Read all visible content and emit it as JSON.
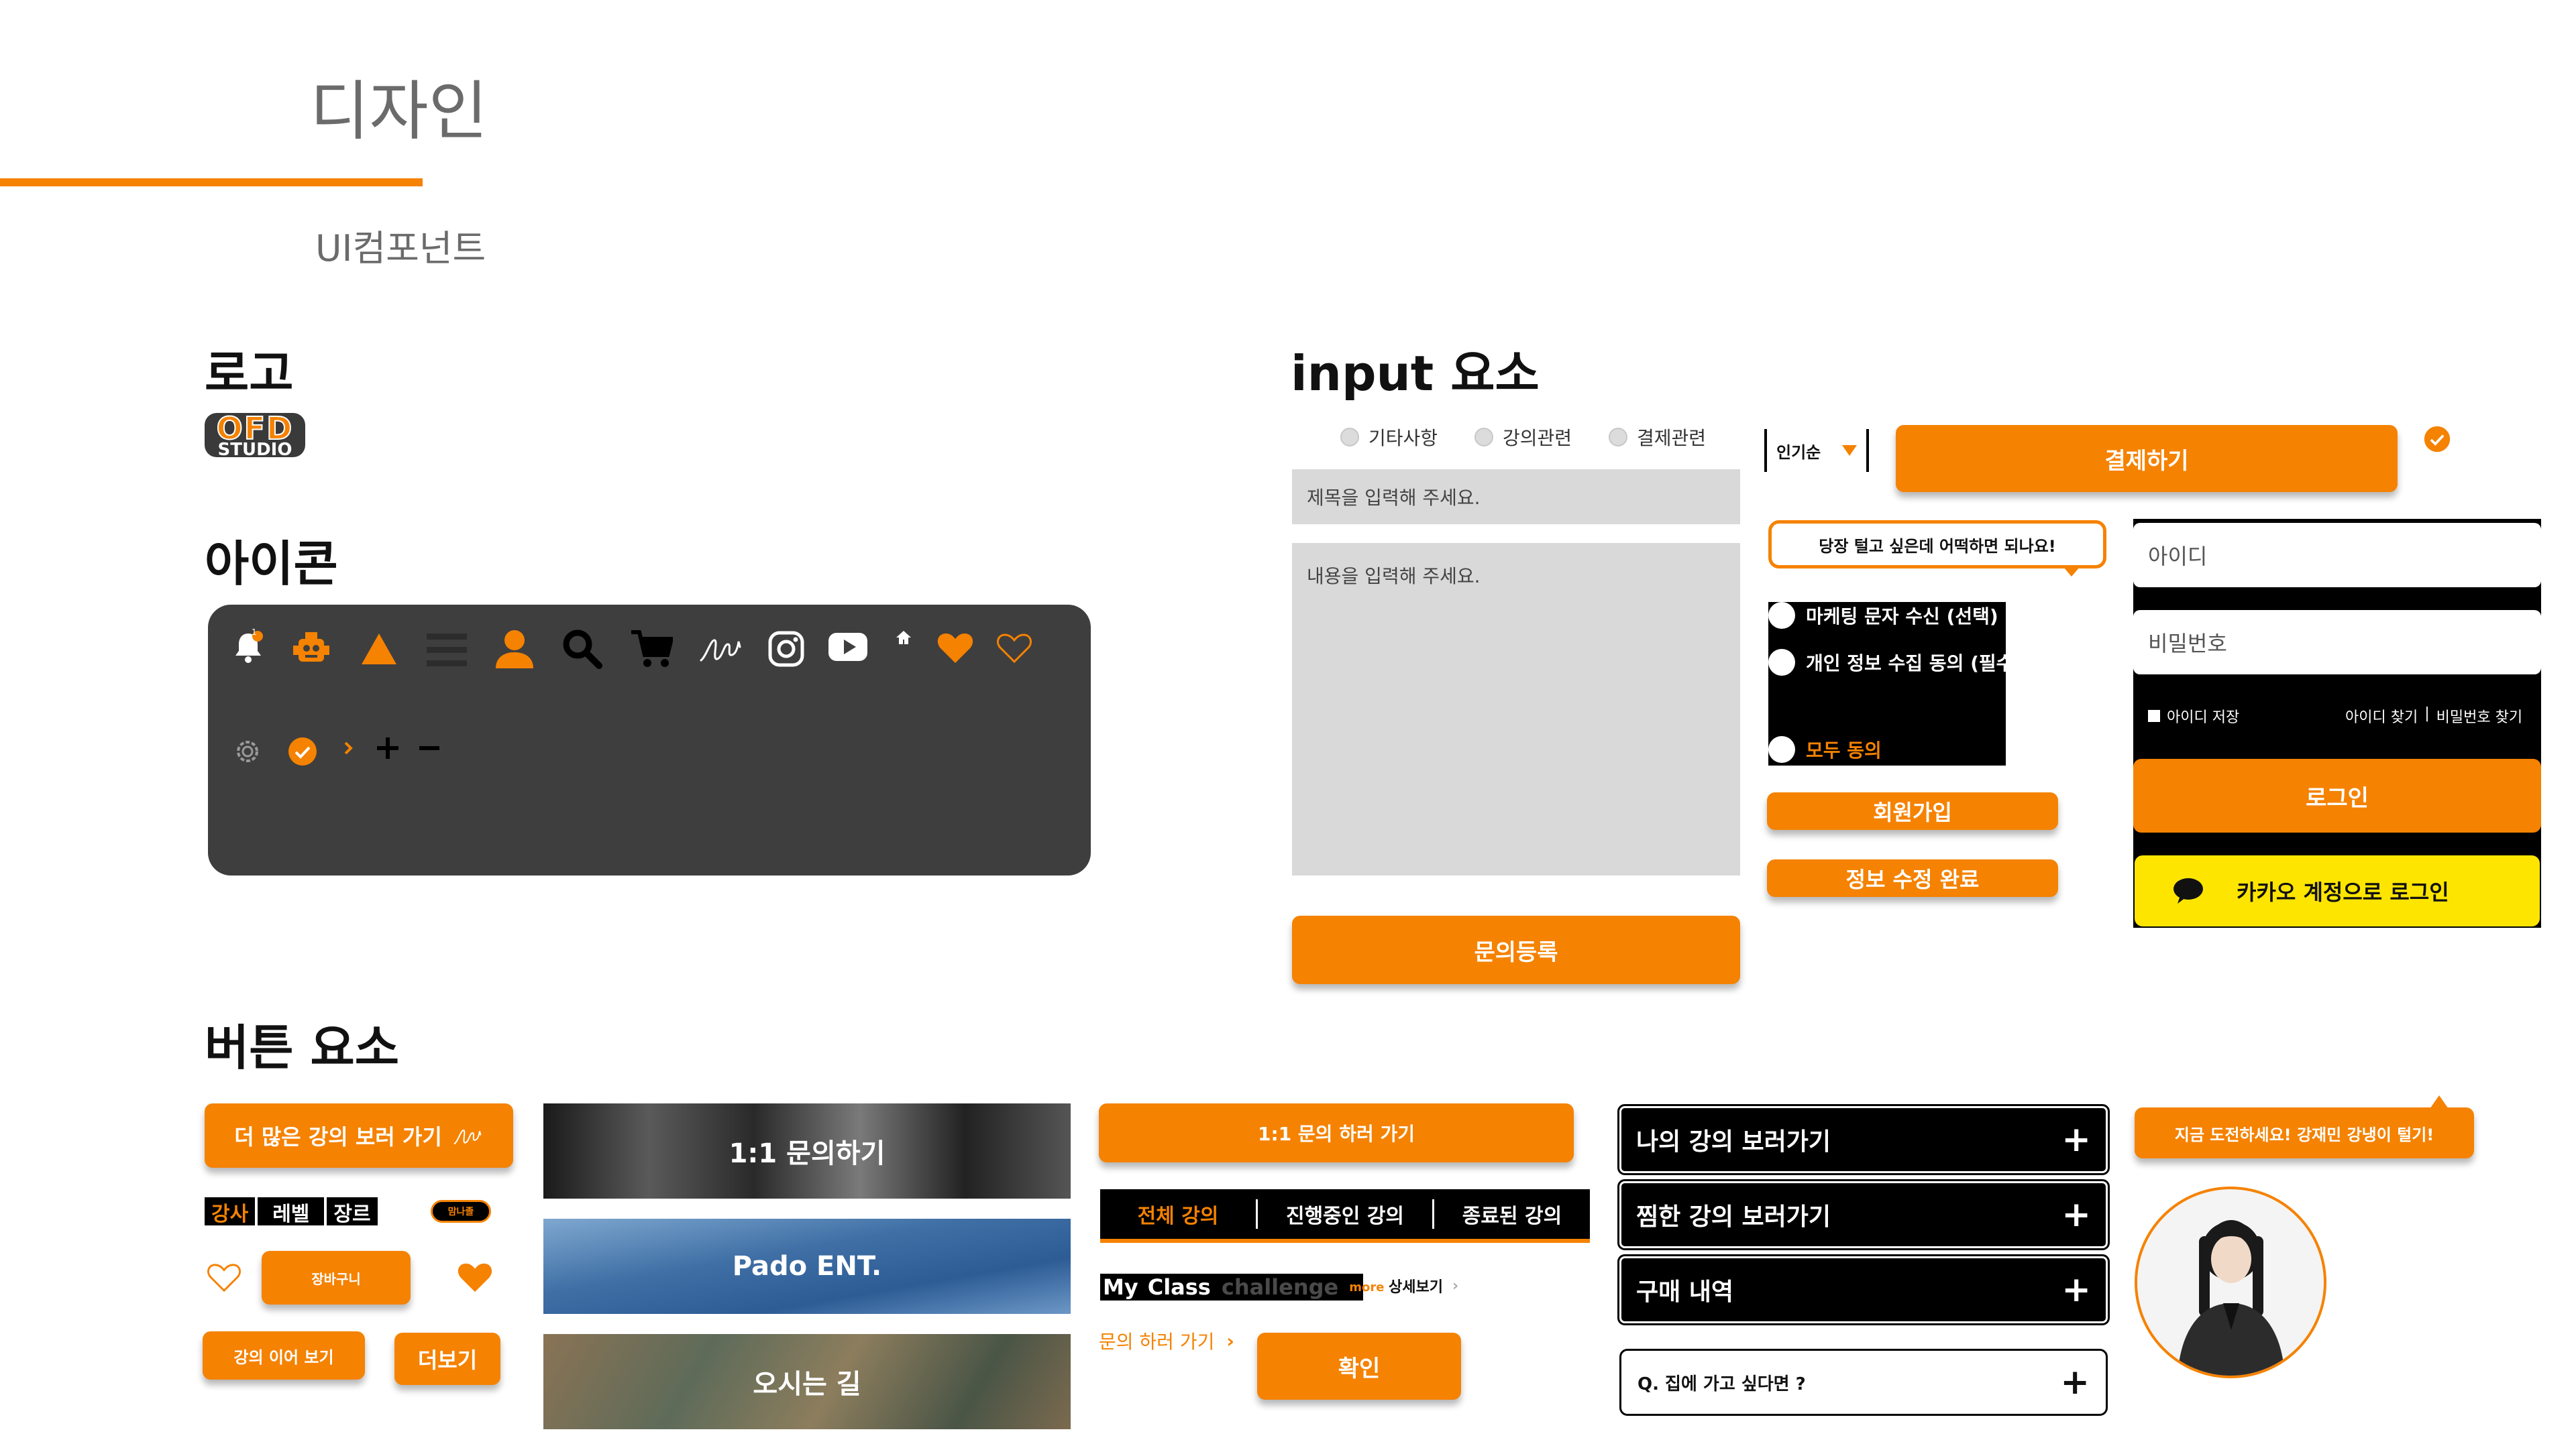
{
  "header": {
    "title": "디자인",
    "subtitle": "UI컴포넌트"
  },
  "sections": {
    "logo": "로고",
    "icons": "아이콘",
    "input": "input 요소",
    "buttons": "버튼 요소"
  },
  "logo": {
    "top": "OFD",
    "bottom": "STUDIO"
  },
  "icons_row1": [
    "bell-icon",
    "robot-icon",
    "triangle-icon",
    "menu-icon",
    "user-icon",
    "search-icon",
    "cart-icon",
    "signature-icon",
    "instagram-icon",
    "youtube-icon",
    "home-icon",
    "heart-filled-icon",
    "heart-outline-icon"
  ],
  "icons_row2": [
    "gear-icon",
    "check-circle-icon",
    "chevron-right-icon",
    "plus-icon",
    "minus-icon"
  ],
  "bell_badge": "1",
  "input": {
    "categories": [
      "기타사항",
      "강의관련",
      "결제관련"
    ],
    "title_placeholder": "제목을 입력해 주세요.",
    "content_placeholder": "내용을 입력해 주세요.",
    "submit": "문의등록",
    "sort_select": "인기순",
    "pay_button": "결제하기",
    "speech_bubble": "당장 털고 싶은데 어떡하면 되나요!",
    "agree_items": [
      "마케팅 문자 수신 (선택)",
      "개인 정보 수집 동의 (필수)"
    ],
    "agree_all": "모두 동의",
    "signup": "회원가입",
    "edit_done": "정보 수정 완료",
    "login": {
      "id_placeholder": "아이디",
      "pw_placeholder": "비밀번호",
      "save_id": "아이디 저장",
      "find_id": "아이디 찾기",
      "divider": "|",
      "find_pw": "비밀번호 찾기",
      "login_button": "로그인",
      "kakao_button": "카카오 계정으로 로그인"
    }
  },
  "buttons": {
    "more_lectures": "더 많은 강의 보러 가기",
    "filter_tags": [
      "강사",
      "레벨",
      "장르"
    ],
    "badge": "맘나졸",
    "cart": "장바구니",
    "continue": "강의 이어 보기",
    "more": "더보기",
    "image_cards": [
      "1:1 문의하기",
      "Pado ENT.",
      "오시는 길"
    ],
    "qna": "1:1 문의 하러 가기",
    "tabs": [
      "전체 강의",
      "진행중인 강의",
      "종료된 강의"
    ],
    "myclass": {
      "my": "My",
      "class": "Class",
      "challenge": "challenge",
      "more": "more",
      "detail": "상세보기"
    },
    "inquiry_link": "문의 하러 가기",
    "confirm": "확인",
    "accordion": [
      "나의 강의 보러가기",
      "찜한 강의 보러가기",
      "구매 내역"
    ],
    "faq": "Q. 집에 가고 싶다면 ?",
    "challenge_bubble": "지금 도전하세요! 강재민 강냉이 털기!"
  },
  "colors": {
    "accent": "#f58200",
    "dark_panel": "#3e3e3e",
    "kakao": "#fee500",
    "input_bg": "#d9d9d9"
  }
}
